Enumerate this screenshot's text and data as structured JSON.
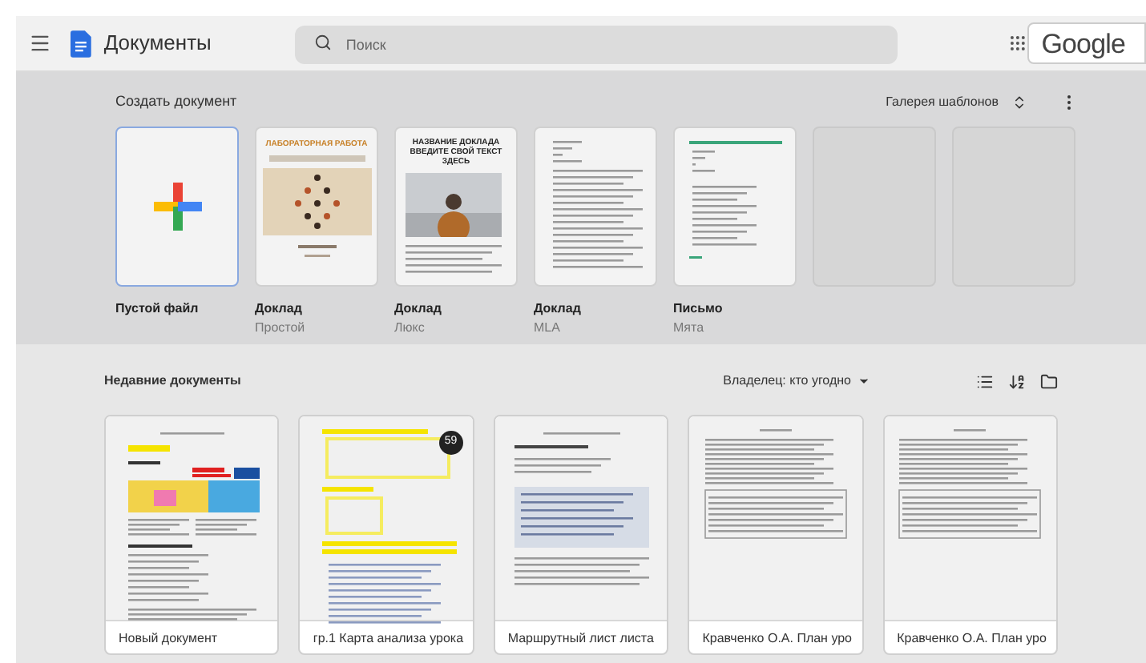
{
  "app": {
    "title": "Документы",
    "search": {
      "placeholder": "Поиск"
    },
    "account_label": "Google"
  },
  "templates": {
    "heading": "Создать документ",
    "gallery_label": "Галерея шаблонов",
    "gallery_expanded": false,
    "items": [
      {
        "kind": "blank",
        "title": "Пустой файл",
        "selected": true
      },
      {
        "kind": "lab",
        "title": "Доклад",
        "subtitle": "Простой",
        "cover_title": "ЛАБОРАТОРНАЯ РАБОТА",
        "selected": false
      },
      {
        "title": "Доклад",
        "subtitle": "Люкс",
        "cover_title": "НАЗВАНИЕ ДОКЛАДА ВВЕДИТЕ СВОЙ ТЕКСТ ЗДЕСЬ",
        "selected": false
      },
      {
        "kind": "text",
        "title": "Доклад",
        "subtitle": "MLA",
        "selected": false
      },
      {
        "kind": "letter",
        "title": "Письмо",
        "subtitle": "Мята",
        "selected": false
      },
      {
        "kind": "empty",
        "selected": false
      },
      {
        "kind": "empty",
        "selected": false
      }
    ]
  },
  "recent": {
    "heading": "Недавние документы",
    "owner_filter": "Владелец: кто угодно",
    "documents": [
      {
        "kind": "table",
        "title": "Новый документ"
      },
      {
        "kind": "screens",
        "title": "гр.1 Карта анализа урока",
        "badge": "59"
      },
      {
        "kind": "text",
        "title": "Маршрутный лист листа"
      },
      {
        "kind": "plan",
        "title": "Кравченко О.А. План уро"
      },
      {
        "kind": "plan",
        "title": "Кравченко О.А. План уро"
      }
    ]
  }
}
